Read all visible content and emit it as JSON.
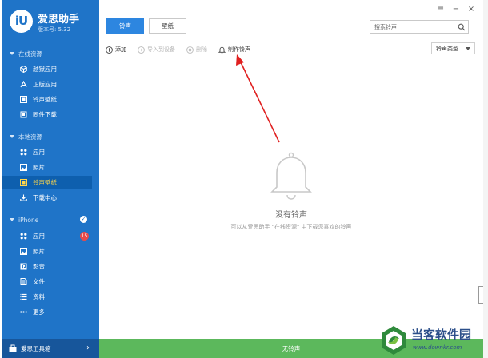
{
  "brand": {
    "logo_text": "iU",
    "name": "爱思助手",
    "version": "版本号: 5.32"
  },
  "sidebar": {
    "sections": [
      {
        "title": "在线资源",
        "items": [
          {
            "label": "越狱应用",
            "icon": "cube-icon"
          },
          {
            "label": "正版应用",
            "icon": "app-store-icon"
          },
          {
            "label": "铃声壁纸",
            "icon": "film-icon"
          },
          {
            "label": "固件下载",
            "icon": "firmware-icon"
          }
        ]
      },
      {
        "title": "本地资源",
        "items": [
          {
            "label": "应用",
            "icon": "apps-grid-icon"
          },
          {
            "label": "照片",
            "icon": "photo-icon"
          },
          {
            "label": "铃声壁纸",
            "icon": "film-icon",
            "active": true
          },
          {
            "label": "下载中心",
            "icon": "download-icon"
          }
        ]
      },
      {
        "title": "iPhone",
        "items": [
          {
            "label": "应用",
            "icon": "apps-grid-icon",
            "badge": "15"
          },
          {
            "label": "照片",
            "icon": "photo-icon"
          },
          {
            "label": "影音",
            "icon": "music-icon"
          },
          {
            "label": "文件",
            "icon": "file-icon"
          },
          {
            "label": "资料",
            "icon": "list-icon"
          },
          {
            "label": "更多",
            "icon": "more-icon"
          }
        ]
      }
    ],
    "toolbox_label": "爱思工具箱",
    "toolbox_chevron": "›"
  },
  "tabs": [
    {
      "label": "铃声",
      "active": true
    },
    {
      "label": "壁纸",
      "active": false
    }
  ],
  "window_controls": {
    "menu": "≡",
    "minimize": "−",
    "close": "×"
  },
  "search": {
    "placeholder": "搜索铃声"
  },
  "actions": [
    {
      "label": "添加",
      "enabled": true
    },
    {
      "label": "导入到设备",
      "enabled": false
    },
    {
      "label": "删除",
      "enabled": false
    },
    {
      "label": "制作铃声",
      "enabled": true
    }
  ],
  "type_select": {
    "value": "铃声类型"
  },
  "empty_state": {
    "title": "没有铃声",
    "description": "可以从爱思助手 \"在线资源\" 中下载您喜欢的铃声"
  },
  "status_bar": {
    "text": "无铃声"
  },
  "watermark": {
    "title": "当客软件园",
    "url": "www.downkr.com"
  },
  "colors": {
    "sidebar_bg": "#1f74c8",
    "active_tab": "#2d86e0",
    "status_bar": "#5cb85c",
    "annotation_arrow": "#e02020",
    "badge": "#e84a4a",
    "active_item_text": "#ffd74a"
  }
}
